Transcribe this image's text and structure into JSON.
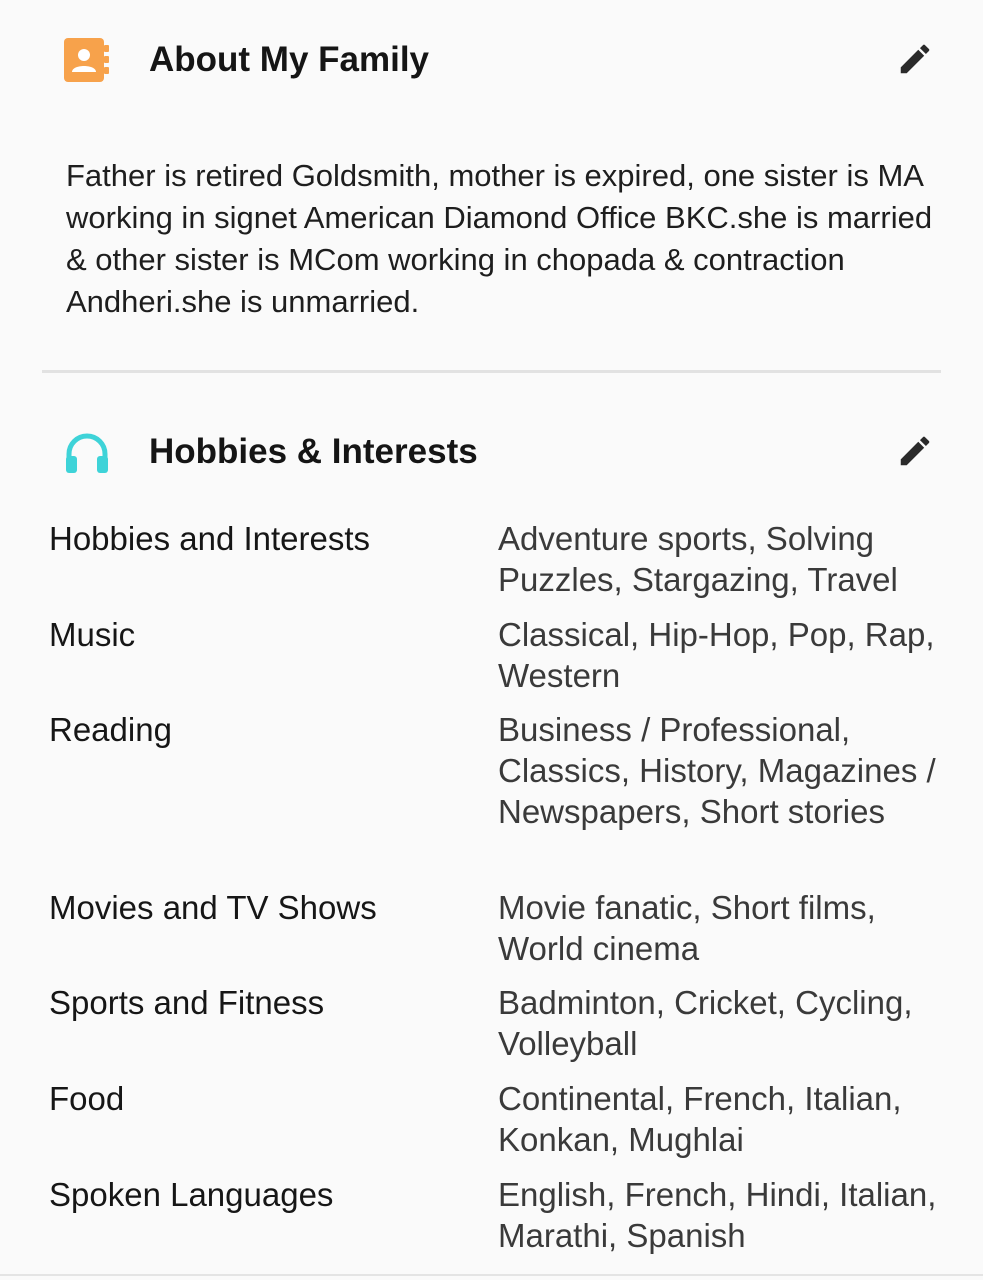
{
  "family": {
    "title": "About My Family",
    "icon": "contact-book-icon",
    "icon_color": "#f7a24b",
    "edit_icon": "pencil-icon",
    "description": "Father is retired Goldsmith, mother is expired, one sister is MA working in signet American Diamond Office BKC.she is married & other sister is MCom working in chopada & contraction Andheri.she is unmarried."
  },
  "hobbies": {
    "title": "Hobbies & Interests",
    "icon": "headphones-icon",
    "icon_color": "#3ed3d8",
    "edit_icon": "pencil-icon",
    "rows": [
      {
        "label": "Hobbies and Interests",
        "value": "Adventure sports, Solving Puzzles, Stargazing, Travel"
      },
      {
        "label": "Music",
        "value": "Classical, Hip-Hop, Pop, Rap, Western"
      },
      {
        "label": "Reading",
        "value": "Business / Professional, Classics, History, Magazines / Newspapers, Short stories"
      },
      {
        "label": "Movies and TV Shows",
        "value": "Movie fanatic, Short films, World cinema"
      },
      {
        "label": "Sports and Fitness",
        "value": "Badminton, Cricket, Cycling, Volleyball"
      },
      {
        "label": "Food",
        "value": "Continental, French, Italian, Konkan, Mughlai"
      },
      {
        "label": "Spoken Languages",
        "value": "English, French, Hindi, Italian, Marathi, Spanish"
      }
    ]
  }
}
